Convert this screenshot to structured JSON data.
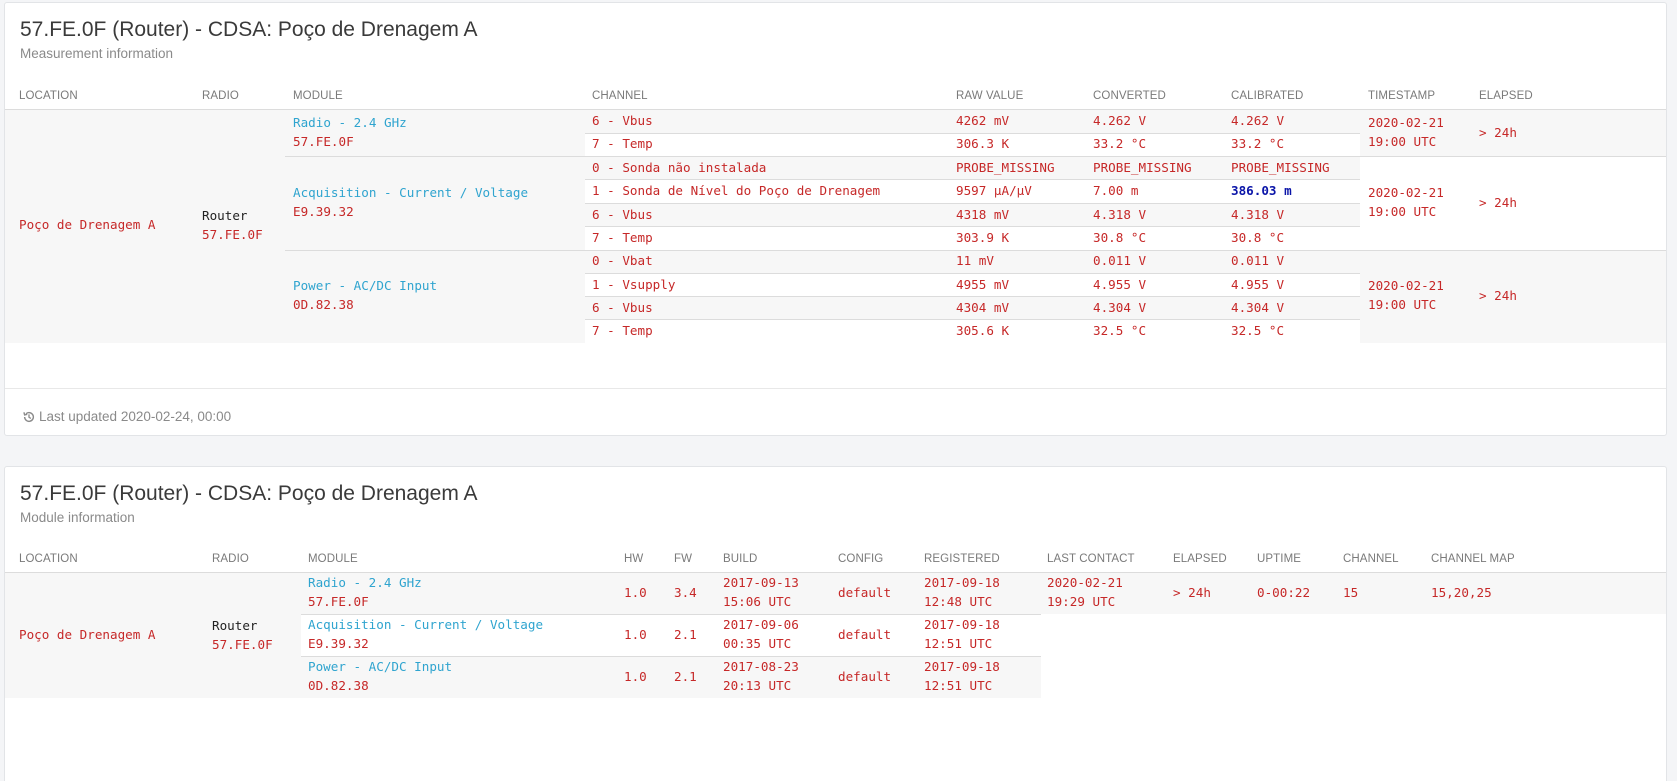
{
  "measurement": {
    "title": "57.FE.0F (Router) - CDSA: Poço de Drenagem A",
    "subtitle": "Measurement information",
    "headers": {
      "location": "LOCATION",
      "radio": "RADIO",
      "module": "MODULE",
      "channel": "CHANNEL",
      "raw": "RAW VALUE",
      "converted": "CONVERTED",
      "calibrated": "CALIBRATED",
      "timestamp": "TIMESTAMP",
      "elapsed": "ELAPSED"
    },
    "location": "Poço de Drenagem A",
    "radio": {
      "type": "Router",
      "address": "57.FE.0F"
    },
    "groups": [
      {
        "module_name": "Radio - 2.4 GHz",
        "module_addr": "57.FE.0F",
        "timestamp_date": "2020-02-21",
        "timestamp_time": "19:00 UTC",
        "elapsed": "> 24h",
        "rows": [
          {
            "channel": "6 - Vbus",
            "raw": "4262 mV",
            "converted": "4.262 V",
            "calibrated": "4.262 V"
          },
          {
            "channel": "7 - Temp",
            "raw": "306.3 K",
            "converted": "33.2 °C",
            "calibrated": "33.2 °C"
          }
        ]
      },
      {
        "module_name": "Acquisition - Current / Voltage",
        "module_addr": "E9.39.32",
        "timestamp_date": "2020-02-21",
        "timestamp_time": "19:00 UTC",
        "elapsed": "> 24h",
        "rows": [
          {
            "channel": "0 - Sonda não instalada",
            "raw": "PROBE_MISSING",
            "converted": "PROBE_MISSING",
            "calibrated": "PROBE_MISSING"
          },
          {
            "channel": "1 - Sonda de Nível do Poço de Drenagem",
            "raw": "9597 µA/µV",
            "converted": "7.00 m",
            "calibrated": "386.03 m"
          },
          {
            "channel": "6 - Vbus",
            "raw": "4318 mV",
            "converted": "4.318 V",
            "calibrated": "4.318 V"
          },
          {
            "channel": "7 - Temp",
            "raw": "303.9 K",
            "converted": "30.8 °C",
            "calibrated": "30.8 °C"
          }
        ]
      },
      {
        "module_name": "Power - AC/DC Input",
        "module_addr": "0D.82.38",
        "timestamp_date": "2020-02-21",
        "timestamp_time": "19:00 UTC",
        "elapsed": "> 24h",
        "rows": [
          {
            "channel": "0 - Vbat",
            "raw": "11 mV",
            "converted": "0.011 V",
            "calibrated": "0.011 V"
          },
          {
            "channel": "1 - Vsupply",
            "raw": "4955 mV",
            "converted": "4.955 V",
            "calibrated": "4.955 V"
          },
          {
            "channel": "6 - Vbus",
            "raw": "4304 mV",
            "converted": "4.304 V",
            "calibrated": "4.304 V"
          },
          {
            "channel": "7 - Temp",
            "raw": "305.6 K",
            "converted": "32.5 °C",
            "calibrated": "32.5 °C"
          }
        ]
      }
    ],
    "footer": "Last updated 2020-02-24, 00:00",
    "footer_icon": "history-icon"
  },
  "module_info": {
    "title": "57.FE.0F (Router) - CDSA: Poço de Drenagem A",
    "subtitle": "Module information",
    "headers": {
      "location": "LOCATION",
      "radio": "RADIO",
      "module": "MODULE",
      "hw": "HW",
      "fw": "FW",
      "build": "BUILD",
      "config": "CONFIG",
      "registered": "REGISTERED",
      "last_contact": "LAST CONTACT",
      "elapsed": "ELAPSED",
      "uptime": "UPTIME",
      "channel": "CHANNEL",
      "channel_map": "CHANNEL MAP"
    },
    "location": "Poço de Drenagem A",
    "radio": {
      "type": "Router",
      "address": "57.FE.0F"
    },
    "last_contact_date": "2020-02-21",
    "last_contact_time": "19:29 UTC",
    "elapsed": "> 24h",
    "uptime": "0-00:22",
    "channel": "15",
    "channel_map": "15,20,25",
    "modules": [
      {
        "name": "Radio - 2.4 GHz",
        "addr": "57.FE.0F",
        "hw": "1.0",
        "fw": "3.4",
        "build_date": "2017-09-13",
        "build_time": "15:06 UTC",
        "config": "default",
        "reg_date": "2017-09-18",
        "reg_time": "12:48 UTC"
      },
      {
        "name": "Acquisition - Current / Voltage",
        "addr": "E9.39.32",
        "hw": "1.0",
        "fw": "2.1",
        "build_date": "2017-09-06",
        "build_time": "00:35 UTC",
        "config": "default",
        "reg_date": "2017-09-18",
        "reg_time": "12:51 UTC"
      },
      {
        "name": "Power - AC/DC Input",
        "addr": "0D.82.38",
        "hw": "1.0",
        "fw": "2.1",
        "build_date": "2017-08-23",
        "build_time": "20:13 UTC",
        "config": "default",
        "reg_date": "2017-09-18",
        "reg_time": "12:51 UTC"
      }
    ]
  }
}
